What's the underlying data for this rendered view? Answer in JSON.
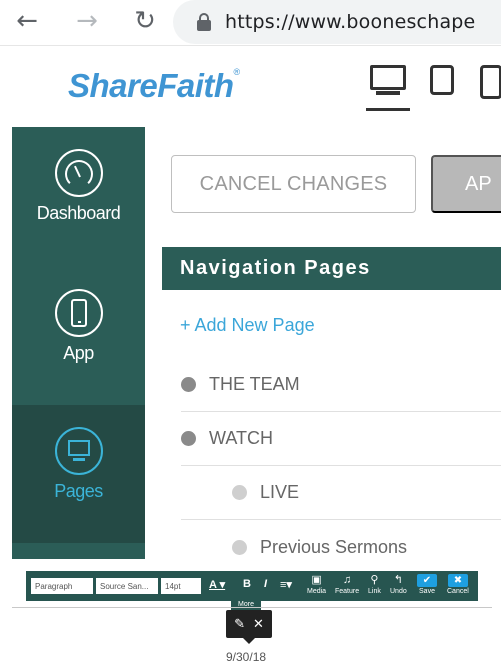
{
  "browser": {
    "back_icon": "arrow-left-icon",
    "forward_icon": "arrow-right-icon",
    "reload_icon": "reload-icon",
    "lock_icon": "lock-icon",
    "url": "https://www.booneschape"
  },
  "header": {
    "logo_text": "ShareFaith",
    "logo_mark": "®",
    "devices": [
      "desktop-icon",
      "tablet-icon",
      "phone-icon"
    ],
    "active_device": "desktop"
  },
  "sidebar": {
    "items": [
      {
        "label": "Dashboard",
        "icon": "gauge-icon",
        "active": false
      },
      {
        "label": "App",
        "icon": "phone-icon",
        "active": false
      },
      {
        "label": "Pages",
        "icon": "monitor-icon",
        "active": true
      }
    ]
  },
  "actions": {
    "cancel_label": "CANCEL CHANGES",
    "apply_label": "AP"
  },
  "navigation": {
    "title": "Navigation Pages",
    "add_label": "+ Add New Page",
    "pages": [
      {
        "label": "THE TEAM",
        "level": 0
      },
      {
        "label": "WATCH",
        "level": 0
      },
      {
        "label": "LIVE",
        "level": 1
      },
      {
        "label": "Previous Sermons",
        "level": 1
      }
    ]
  },
  "toolbar": {
    "format_value": "Paragraph",
    "font_value": "Source San...",
    "size_value": "14pt",
    "more_tooltip": "More",
    "tools": [
      "Media",
      "Feature",
      "Link",
      "Undo",
      "Save",
      "Cancel"
    ]
  },
  "footer": {
    "date": "9/30/18"
  },
  "colors": {
    "sidebar": "#2b5d57",
    "accent": "#3bb4d8",
    "logo": "#3f95d3",
    "save": "#1e9fe0"
  }
}
